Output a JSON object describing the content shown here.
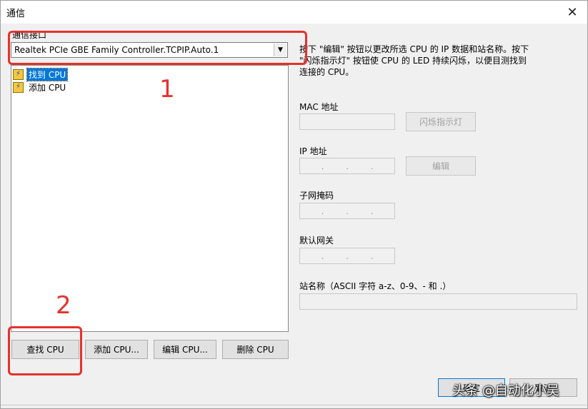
{
  "window": {
    "title": "通信"
  },
  "interface": {
    "label": "通信接口",
    "selected": "Realtek PCIe GBE Family Controller.TCPIP.Auto.1"
  },
  "tree": {
    "items": [
      {
        "label": "找到 CPU",
        "selected": true,
        "icon": "lightning-icon"
      },
      {
        "label": "添加 CPU",
        "selected": false,
        "icon": "lightning-icon"
      }
    ]
  },
  "buttons": {
    "find_cpu": "查找 CPU",
    "add_cpu": "添加 CPU...",
    "edit_cpu": "编辑 CPU...",
    "delete_cpu": "删除 CPU",
    "flash_led": "闪烁指示灯",
    "edit": "编辑",
    "ok": "确定",
    "cancel": "取消"
  },
  "description": {
    "line1": "按下 \"编辑\" 按钮以更改所选 CPU 的 IP 数据和站名称。按下",
    "line2": "\"闪烁指示灯\" 按钮使 CPU 的 LED 持续闪烁，以便目测找到",
    "line3": "连接的 CPU。"
  },
  "fields": {
    "mac_label": "MAC 地址",
    "ip_label": "IP 地址",
    "subnet_label": "子网掩码",
    "gateway_label": "默认网关",
    "station_label": "站名称（ASCII 字符 a-z、0-9、- 和 .）",
    "ip_dot": "."
  },
  "annotations": {
    "box1_number": "1",
    "box2_number": "2"
  },
  "watermark": "头条 @自动化小吴",
  "colors": {
    "annotation_red": "#e5322d",
    "selection_blue": "#0078d7"
  }
}
